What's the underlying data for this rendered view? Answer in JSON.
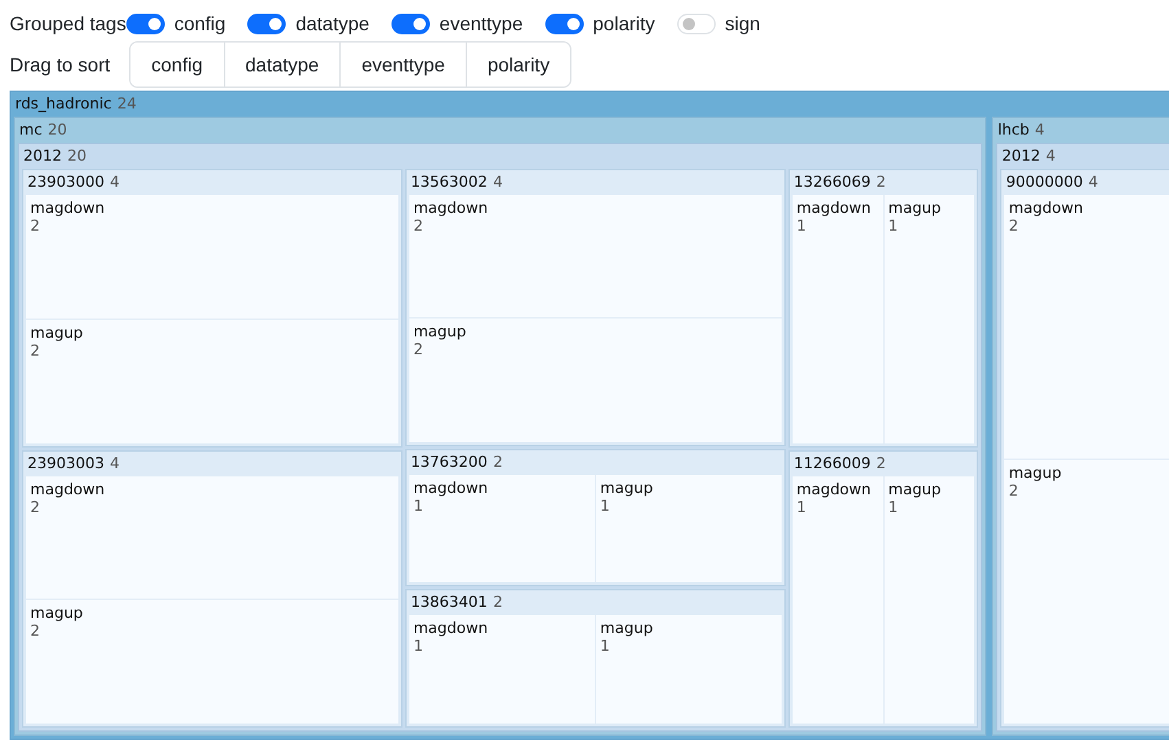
{
  "grouped_tags": {
    "label": "Grouped tags",
    "toggles": [
      {
        "label": "config",
        "on": true
      },
      {
        "label": "datatype",
        "on": true
      },
      {
        "label": "eventtype",
        "on": true
      },
      {
        "label": "polarity",
        "on": true
      },
      {
        "label": "sign",
        "on": false
      }
    ]
  },
  "sort": {
    "label": "Drag to sort",
    "items": [
      "config",
      "datatype",
      "eventtype",
      "polarity"
    ]
  },
  "treemap": {
    "name": "rds_hadronic",
    "count": "24",
    "children": [
      {
        "name": "mc",
        "count": "20",
        "children": [
          {
            "name": "2012",
            "count": "20",
            "children": [
              {
                "name": "23903000",
                "count": "4",
                "children": [
                  {
                    "name": "magdown",
                    "count": "2"
                  },
                  {
                    "name": "magup",
                    "count": "2"
                  }
                ]
              },
              {
                "name": "23903003",
                "count": "4",
                "children": [
                  {
                    "name": "magdown",
                    "count": "2"
                  },
                  {
                    "name": "magup",
                    "count": "2"
                  }
                ]
              },
              {
                "name": "13563002",
                "count": "4",
                "children": [
                  {
                    "name": "magdown",
                    "count": "2"
                  },
                  {
                    "name": "magup",
                    "count": "2"
                  }
                ]
              },
              {
                "name": "13763200",
                "count": "2",
                "children": [
                  {
                    "name": "magdown",
                    "count": "1"
                  },
                  {
                    "name": "magup",
                    "count": "1"
                  }
                ]
              },
              {
                "name": "13863401",
                "count": "2",
                "children": [
                  {
                    "name": "magdown",
                    "count": "1"
                  },
                  {
                    "name": "magup",
                    "count": "1"
                  }
                ]
              },
              {
                "name": "13266069",
                "count": "2",
                "children": [
                  {
                    "name": "magdown",
                    "count": "1"
                  },
                  {
                    "name": "magup",
                    "count": "1"
                  }
                ]
              },
              {
                "name": "11266009",
                "count": "2",
                "children": [
                  {
                    "name": "magdown",
                    "count": "1"
                  },
                  {
                    "name": "magup",
                    "count": "1"
                  }
                ]
              }
            ]
          }
        ]
      },
      {
        "name": "lhcb",
        "count": "4",
        "children": [
          {
            "name": "2012",
            "count": "4",
            "children": [
              {
                "name": "90000000",
                "count": "4",
                "children": [
                  {
                    "name": "magdown",
                    "count": "2"
                  },
                  {
                    "name": "magup",
                    "count": "2"
                  }
                ]
              }
            ]
          }
        ]
      }
    ]
  }
}
